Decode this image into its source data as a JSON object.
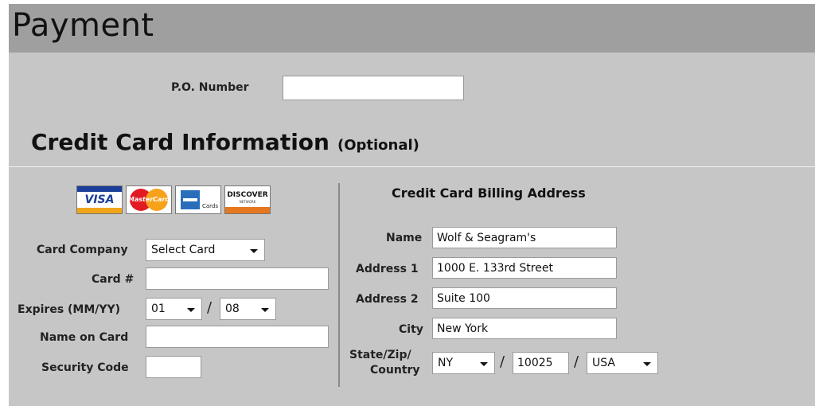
{
  "page": {
    "title": "Payment"
  },
  "po": {
    "label": "P.O. Number",
    "value": ""
  },
  "credit_card": {
    "heading": "Credit Card Information",
    "optional": "(Optional)",
    "logos": {
      "visa": "VISA",
      "mastercard": "MasterCard",
      "amex_caption": "Cards",
      "discover": "DISCOVER",
      "discover_sub": "NETWORK"
    },
    "company": {
      "label": "Card Company",
      "selected": "Select Card"
    },
    "number": {
      "label": "Card #",
      "value": ""
    },
    "expires": {
      "label": "Expires (MM/YY)",
      "month": "01",
      "separator": "/",
      "year": "08"
    },
    "name_on_card": {
      "label": "Name on Card",
      "value": ""
    },
    "security_code": {
      "label": "Security Code",
      "value": ""
    }
  },
  "billing": {
    "heading": "Credit Card Billing Address",
    "name": {
      "label": "Name",
      "value": "Wolf & Seagram's"
    },
    "address1": {
      "label": "Address 1",
      "value": "1000 E. 133rd Street"
    },
    "address2": {
      "label": "Address 2",
      "value": "Suite 100"
    },
    "city": {
      "label": "City",
      "value": "New York"
    },
    "state_zip_country": {
      "label_line1": "State/Zip/",
      "label_line2": "Country",
      "state": "NY",
      "sep1": "/",
      "zip": "10025",
      "sep2": "/",
      "country": "USA"
    }
  }
}
